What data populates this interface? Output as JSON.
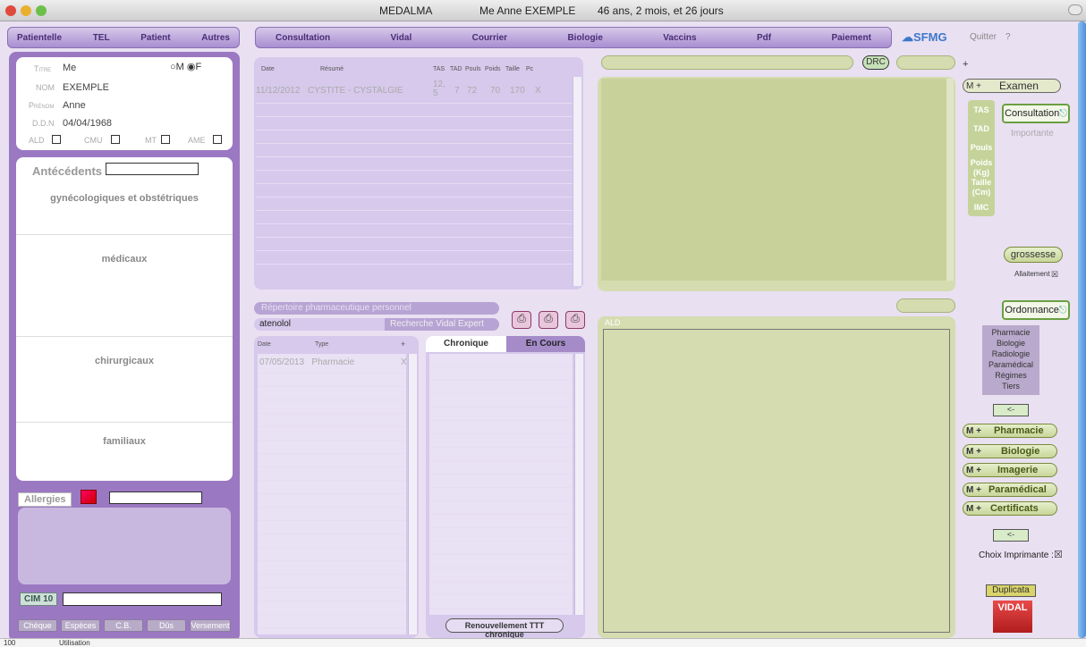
{
  "window": {
    "title_app": "MEDALMA",
    "title_patient": "Me Anne EXEMPLE",
    "title_age": "46 ans, 2 mois, et 26 jours"
  },
  "leftnav": [
    "Patientelle",
    "TEL",
    "Patient",
    "Autres"
  ],
  "topnav": [
    "Consultation",
    "Vidal",
    "Courrier",
    "Biologie",
    "Vaccins",
    "Pdf",
    "Paiement"
  ],
  "sfmg": "SFMG",
  "quitter": "Quitter",
  "help": "?",
  "patient": {
    "titre_label": "Titre",
    "titre": "Me",
    "nom_label": "NOM",
    "nom": "EXEMPLE",
    "prenom_label": "Prénom",
    "prenom": "Anne",
    "ddn_label": "D.D.N",
    "ddn": "04/04/1968",
    "sex_m": "M",
    "sex_f": "F",
    "ald": "ALD",
    "cmu": "CMU",
    "mt": "MT",
    "ame": "AME"
  },
  "antecedents": {
    "title": "Antécédents",
    "gyn": "gynécologiques et obstétriques",
    "med": "médicaux",
    "chir": "chirurgicaux",
    "fam": "familiaux"
  },
  "allergies": "Allergies",
  "cim10": "CIM 10",
  "payments": [
    "Chèque",
    "Espèces",
    "C.B.",
    "Dûs",
    "Versement"
  ],
  "consult_table": {
    "headers": [
      "Date",
      "Résumé",
      "TAS",
      "TAD",
      "Pouls",
      "Poids",
      "Taille",
      "Pc"
    ],
    "row": {
      "date": "11/12/2012",
      "resume": "CYSTITE - CYSTALGIE",
      "tas": "12,5",
      "tad": "7",
      "pouls": "72",
      "poids": "70",
      "taille": "170",
      "pc": "X"
    }
  },
  "pharma": {
    "placeholder": "Répertoire pharmaceutique personnel",
    "search_value": "atenolol",
    "vidal_search": "Recherche Vidal Expert"
  },
  "ord_table": {
    "headers": [
      "Date",
      "Type",
      "+"
    ],
    "row": {
      "date": "07/05/2013",
      "type": "Pharmacie",
      "x": "X"
    }
  },
  "ttt": {
    "tab1": "Chronique",
    "tab2": "En Cours",
    "renew": "Renouvellement TTT chronique"
  },
  "drc": "DRC",
  "plus": "+",
  "ald_label": "ALD",
  "right": {
    "mplus": "M +",
    "examen": "Examen",
    "consultation": "Consultation",
    "importante": "Importante",
    "vitals": [
      "TAS",
      "TAD",
      "Pouls",
      "Poids (Kg)",
      "Taille (Cm)",
      "IMC"
    ],
    "grossesse": "grossesse",
    "allaitement": "Allaitement",
    "ordonnance": "Ordonnance",
    "ord_list": [
      "Pharmacie",
      "Biologie",
      "Radiologie",
      "Paramédical",
      "Régimes",
      "Tiers"
    ],
    "arrow": "<-",
    "presc": [
      "Pharmacie",
      "Biologie",
      "Imagerie",
      "Paramédical",
      "Certificats"
    ],
    "choix": "Choix Imprimante :",
    "duplicata": "Duplicata",
    "vidal": "VIDAL"
  },
  "status": {
    "zoom": "100",
    "mode": "Utilisation"
  }
}
